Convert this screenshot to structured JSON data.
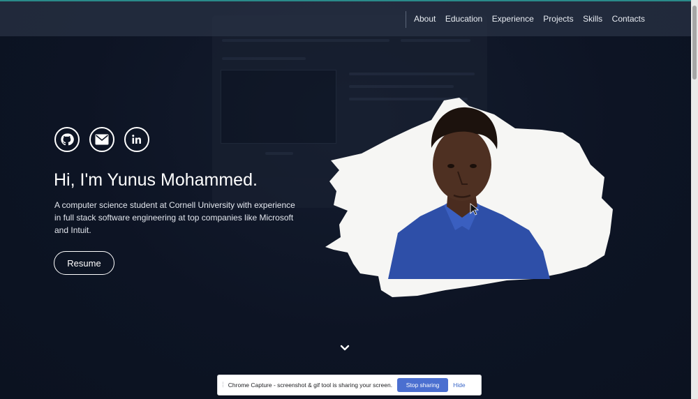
{
  "nav": {
    "links": [
      {
        "label": "About"
      },
      {
        "label": "Education"
      },
      {
        "label": "Experience"
      },
      {
        "label": "Projects"
      },
      {
        "label": "Skills"
      },
      {
        "label": "Contacts"
      }
    ]
  },
  "hero": {
    "social": [
      {
        "icon": "github-icon"
      },
      {
        "icon": "mail-icon"
      },
      {
        "icon": "linkedin-icon"
      }
    ],
    "headline": "Hi, I'm Yunus Mohammed.",
    "bio": "A computer science student at Cornell University with experience in full stack software engineering at top companies like Microsoft and Intuit.",
    "resume_label": "Resume"
  },
  "share_bar": {
    "message": "Chrome Capture - screenshot & gif tool is sharing your screen.",
    "stop_label": "Stop sharing",
    "hide_label": "Hide"
  },
  "colors": {
    "background": "#0d1424",
    "navbar": "#283244",
    "accent_button": "#4b6fd0",
    "text": "#ffffff"
  }
}
